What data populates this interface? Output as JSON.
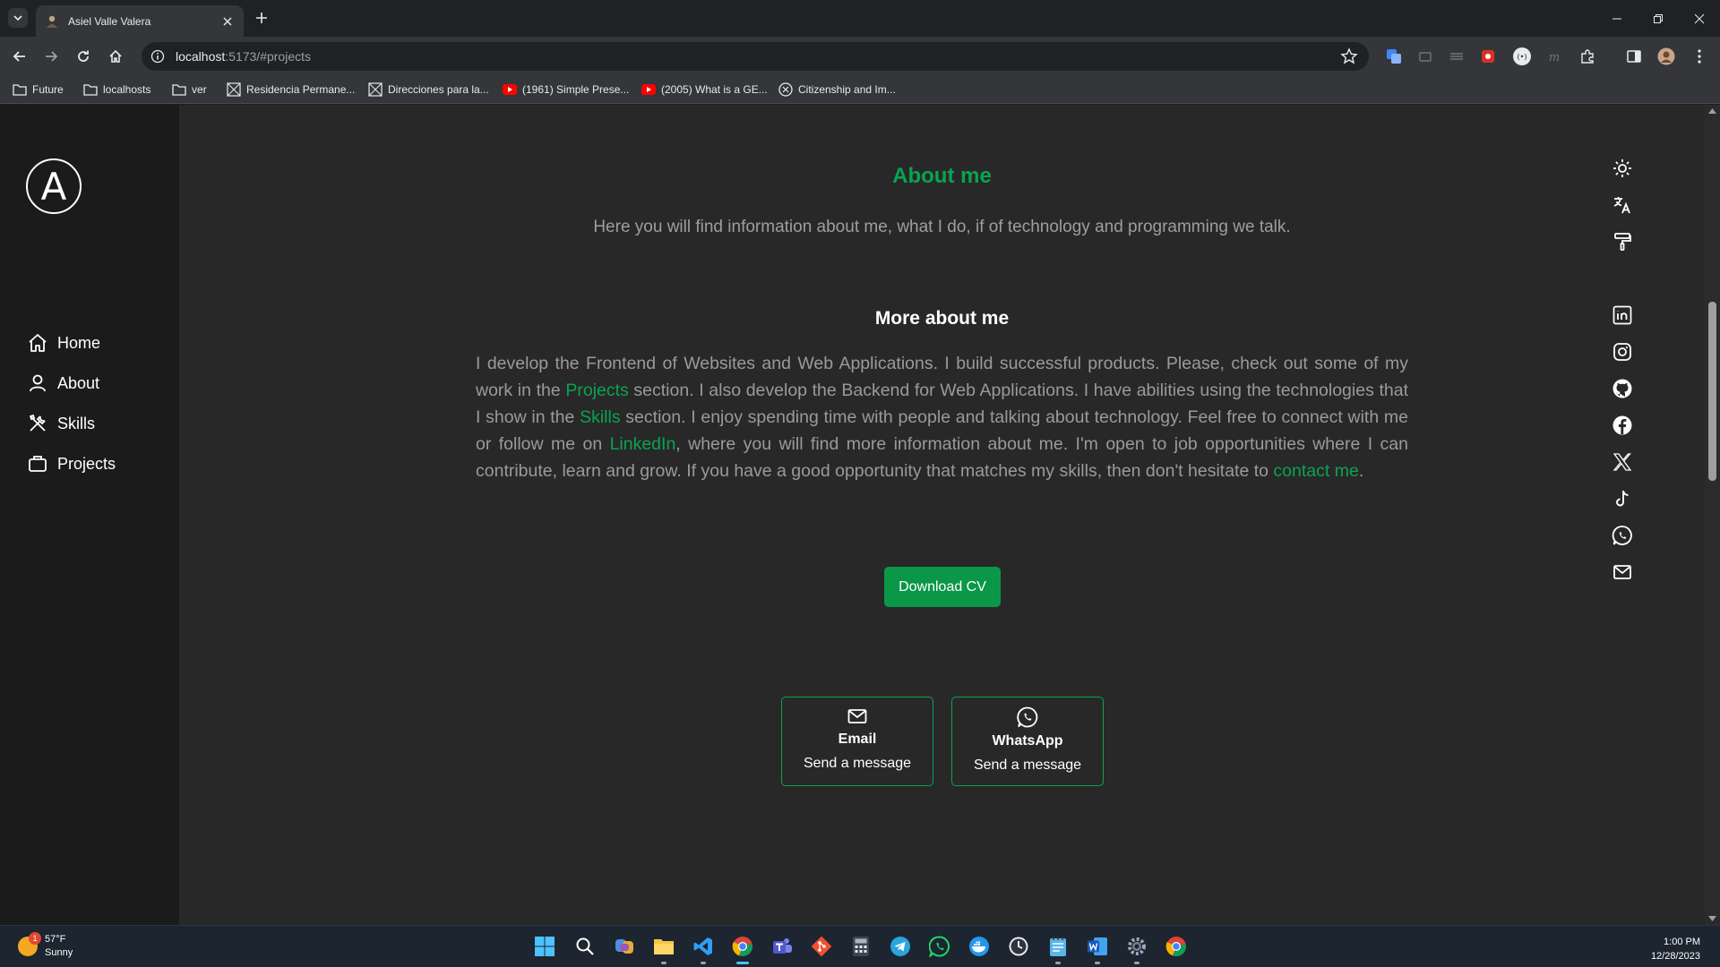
{
  "browser": {
    "tab_title": "Asiel Valle Valera",
    "url_host": "localhost",
    "url_rest": ":5173/#projects",
    "bookmarks": [
      "Future",
      "localhosts",
      "ver",
      "Residencia Permane...",
      "Direcciones para la...",
      "(1961) Simple Prese...",
      "(2005) What is a GE...",
      "Citizenship and Im..."
    ]
  },
  "sidebar": {
    "logo_letter": "A",
    "nav": [
      {
        "label": "Home",
        "icon": "home-icon"
      },
      {
        "label": "About",
        "icon": "user-icon"
      },
      {
        "label": "Skills",
        "icon": "tools-icon"
      },
      {
        "label": "Projects",
        "icon": "briefcase-icon"
      }
    ]
  },
  "main": {
    "title": "About me",
    "subtitle": "Here you will find information about me, what I do, if of technology and programming we talk.",
    "more_title": "More about me",
    "bio": {
      "p1": "I develop the Frontend of Websites and Web Applications. I build successful products. Please, check out some of my work in the ",
      "link_projects": "Projects",
      "p2": " section. I also develop the Backend for Web Applications. I have abilities using the technologies that I show in the ",
      "link_skills": "Skills",
      "p3": " section. I enjoy spending time with people and talking about technology. Feel free to connect with me or follow me on ",
      "link_linkedin": "LinkedIn",
      "p4": ", where you will find more information about me. I'm open to job opportunities where I can contribute, learn and grow. If you have a good opportunity that matches my skills, then don't hesitate to ",
      "link_contact": "contact me",
      "p5": "."
    },
    "cv_button": "Download CV",
    "contacts": [
      {
        "title": "Email",
        "subtitle": "Send a message",
        "icon": "mail-icon"
      },
      {
        "title": "WhatsApp",
        "subtitle": "Send a message",
        "icon": "whatsapp-icon"
      }
    ]
  },
  "right_toolbar": [
    "sun-icon",
    "translate-icon",
    "paint-roller-icon",
    "linkedin-icon",
    "instagram-icon",
    "github-icon",
    "facebook-icon",
    "x-icon",
    "tiktok-icon",
    "whatsapp-icon",
    "mail-icon"
  ],
  "taskbar": {
    "weather_temp": "57°F",
    "weather_desc": "Sunny",
    "weather_badge": "1",
    "time": "1:00 PM",
    "date": "12/28/2023"
  },
  "colors": {
    "accent": "#0aa350",
    "page_bg": "#282828",
    "sidebar_bg": "#1b1b1b",
    "text_muted": "#9a9a9a"
  }
}
